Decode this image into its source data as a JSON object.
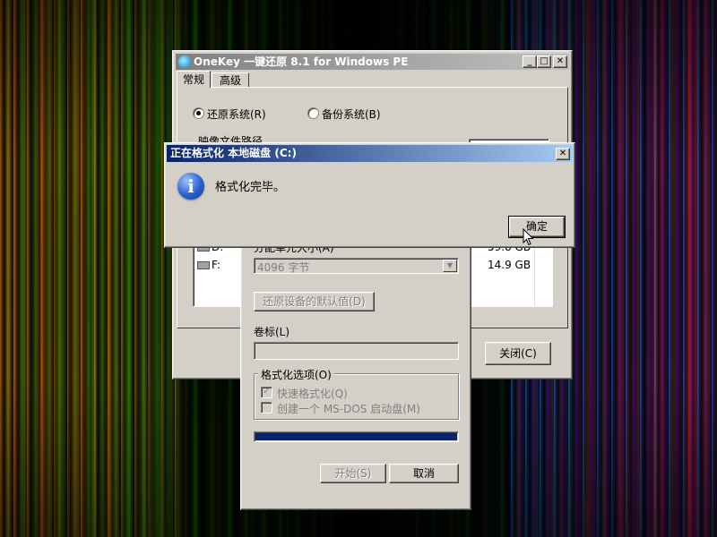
{
  "main_window": {
    "title": "OneKey 一键还原 8.1 for Windows PE",
    "tabs": [
      "常规",
      "高级"
    ],
    "restore_radio": "还原系统(R)",
    "backup_radio": "备份系统(B)",
    "image_path_label": "映像文件路径",
    "drive_rows": [
      {
        "drive": "D:",
        "size": "59.8 GB"
      },
      {
        "drive": "F:",
        "size": "14.9 GB"
      }
    ],
    "close_button": "关闭(C)"
  },
  "format_dialog": {
    "alloc_label": "分配单元大小(A)",
    "alloc_value": "4096 字节",
    "restore_defaults_button": "还原设备的默认值(D)",
    "volume_label": "卷标(L)",
    "volume_value": "",
    "options_group": "格式化选项(O)",
    "quick_format": "快速格式化(Q)",
    "msdos_boot": "创建一个 MS-DOS 启动盘(M)",
    "quick_format_checked": true,
    "msdos_checked": false,
    "progress": 1.0,
    "start_button": "开始(S)",
    "cancel_button": "取消"
  },
  "message_box": {
    "title": "正在格式化 本地磁盘 (C:)",
    "message": "格式化完毕。",
    "ok_button": "确定",
    "close_glyph": "✕"
  },
  "icons": {
    "app_icon": "onekey-icon",
    "info_icon": "information-icon",
    "cursor": "mouse-pointer-icon"
  },
  "colors": {
    "active_title": "#0a246a",
    "progress_fill": "#0a246a",
    "info_icon": "#2b5fd0"
  }
}
